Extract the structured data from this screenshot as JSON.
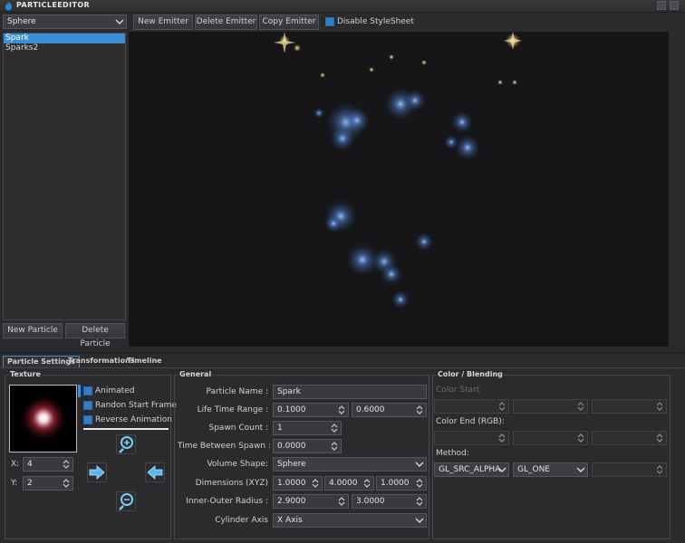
{
  "window": {
    "title": "PARTICLEEDITOR"
  },
  "emitter_shape_select": {
    "value": "Sphere"
  },
  "toolbar": {
    "new_emitter": "New Emitter",
    "delete_emitter": "Delete Emitter",
    "copy_emitter": "Copy Emitter",
    "disable_stylesheet": "Disable StyleSheet",
    "disable_stylesheet_checked": true
  },
  "particles": {
    "items": [
      {
        "label": "Spark",
        "selected": true
      },
      {
        "label": "Sparks2",
        "selected": false
      }
    ],
    "new_particle": "New Particle",
    "delete_particle": "Delete Particle"
  },
  "tabs": [
    {
      "label": "Particle Settings",
      "active": true
    },
    {
      "label": "Transformations",
      "active": false
    },
    {
      "label": "Timeline",
      "active": false
    }
  ],
  "texture": {
    "title": "Texture",
    "animated": "Animated",
    "random_start_frame": "Randon Start Frame",
    "reverse_animation": "Reverse Animation",
    "x_label": "X:",
    "x_value": "4",
    "y_label": "Y:",
    "y_value": "2"
  },
  "general": {
    "title": "General",
    "particle_name_label": "Particle Name :",
    "particle_name_value": "Spark",
    "life_time_label": "Life Time Range :",
    "life_time_min": "0.1000",
    "life_time_max": "0.6000",
    "spawn_count_label": "Spawn Count :",
    "spawn_count_value": "1",
    "time_between_label": "Time Between Spawn :",
    "time_between_value": "0.0000",
    "volume_shape_label": "Volume Shape:",
    "volume_shape_value": "Sphere",
    "dimensions_label": "Dimensions (XYZ)",
    "dim_x": "1.0000",
    "dim_y": "4.0000",
    "dim_z": "1.0000",
    "radius_label": "Inner-Outer Radius :",
    "radius_inner": "2.9000",
    "radius_outer": "3.0000",
    "cylinder_axis_label": "Cylinder Axis",
    "cylinder_axis_value": "X Axis"
  },
  "color": {
    "title": "Color / Blending",
    "color_start_label": "Color Start",
    "color_end_label": "Color End (RGB):",
    "method_label": "Method:",
    "method_src": "GL_SRC_ALPHA",
    "method_dst": "GL_ONE"
  },
  "colors": {
    "accent": "#3b8fd8",
    "viewport": "#161619",
    "panel": "#2b2b2e"
  }
}
